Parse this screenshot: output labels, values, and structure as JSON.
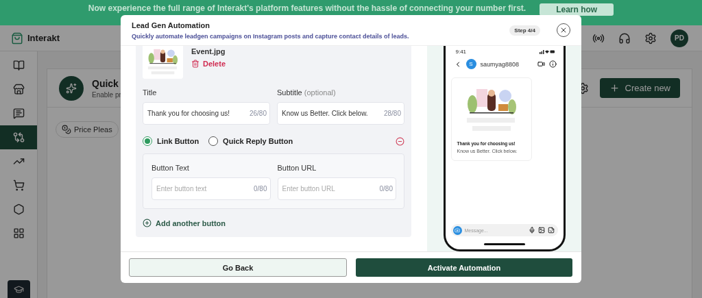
{
  "banner": {
    "text": "Now experience the full range of Interakt's platform features without the hassle of connecting your number first.",
    "button": "Learn how"
  },
  "header": {
    "brand": "Interakt",
    "avatar": "PD"
  },
  "sidebar": {
    "items": [
      {
        "selected": false
      },
      {
        "selected": false
      },
      {
        "selected": false
      },
      {
        "selected": true
      },
      {
        "selected": false
      },
      {
        "selected": false
      },
      {
        "selected": false
      },
      {
        "selected": false
      }
    ]
  },
  "main": {
    "card_title": "Quick",
    "card_subtitle": "Enable pr",
    "chip": "Price Pleas",
    "create_button": "Create new"
  },
  "modal": {
    "title": "Lead Gen Automation",
    "subtitle": "Quickly automate leadgen campaigns on Instagram posts and capture contact details of leads.",
    "step": "Step 4/4",
    "file_name": "Event.jpg",
    "delete_label": "Delete",
    "fields": [
      {
        "label": "Title",
        "value": "Thank you for choosing us!",
        "counter": "26/80"
      },
      {
        "label": "Subtitle",
        "note": "(optional)",
        "value": "Know us Better. Click below.",
        "counter": "28/80"
      }
    ],
    "button_types": [
      {
        "label": "Link Button",
        "selected": true
      },
      {
        "label": "Quick Reply Button",
        "selected": false
      }
    ],
    "button_fields": [
      {
        "label": "Button Text",
        "placeholder": "Enter button text",
        "counter": "0/80"
      },
      {
        "label": "Button URL",
        "placeholder": "Enter button URL",
        "counter": "0/80"
      }
    ],
    "add_button": "Add another button",
    "preview": {
      "time": "9:41",
      "avatar_letter": "S",
      "username": "saumyag8808",
      "card_title": "Thank you for choosing us!",
      "card_subtitle": "Know us Better. Click below.",
      "message_placeholder": "Message..."
    },
    "back_button": "Go Back",
    "activate_button": "Activate Automation"
  }
}
